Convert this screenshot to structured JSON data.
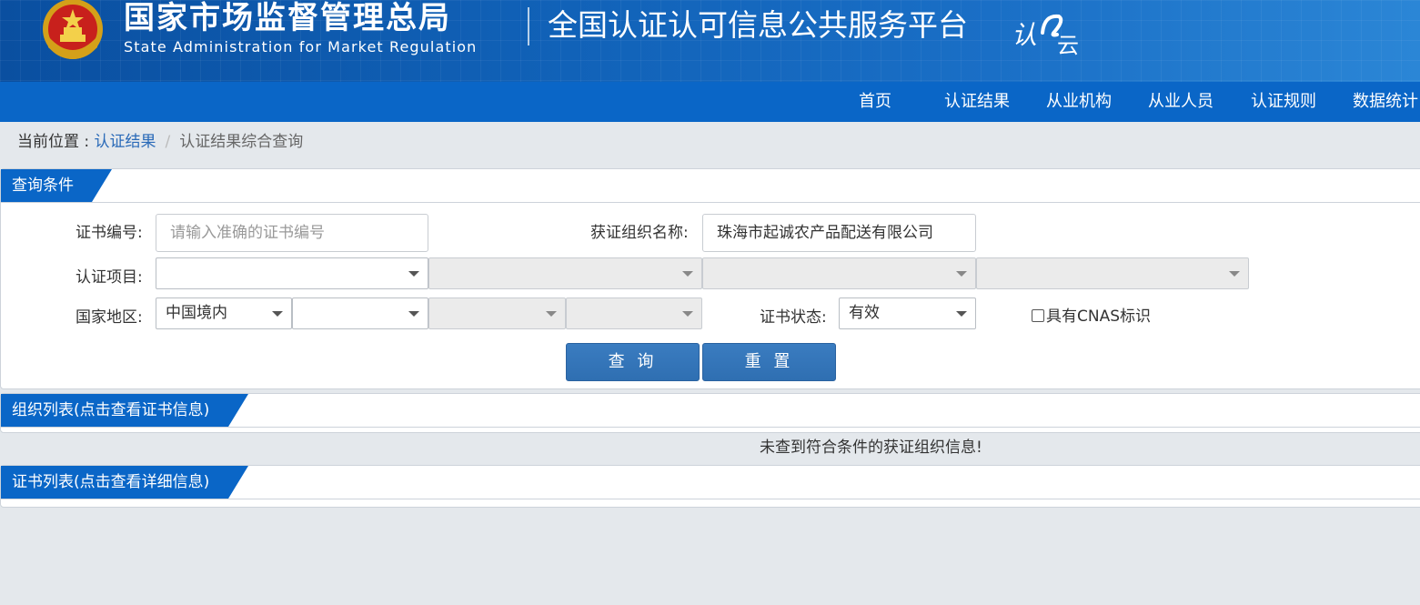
{
  "header": {
    "agency_cn": "国家市场监督管理总局",
    "agency_en": "State Administration for Market Regulation",
    "platform_title": "全国认证认可信息公共服务平台",
    "logo_text": "认云",
    "emblem_icon": "national-emblem-icon",
    "colors": {
      "header_bg": "#1162b8",
      "nav_bg": "#0a66c7",
      "accent": "#2f6fb2"
    }
  },
  "nav": {
    "items": [
      {
        "label": "首页"
      },
      {
        "label": "认证结果"
      },
      {
        "label": "从业机构"
      },
      {
        "label": "从业人员"
      },
      {
        "label": "认证规则"
      },
      {
        "label": "数据统计"
      }
    ]
  },
  "breadcrumb": {
    "prefix": "当前位置 : ",
    "link": "认证结果",
    "separator": "/",
    "current": "认证结果综合查询"
  },
  "query": {
    "title": "查询条件",
    "cert_no_label": "证书编号:",
    "cert_no_placeholder": "请输入准确的证书编号",
    "cert_no_value": "",
    "org_name_label": "获证组织名称:",
    "org_name_value": "珠海市起诚农产品配送有限公司",
    "project_label": "认证项目:",
    "project_selects": [
      "",
      "",
      "",
      ""
    ],
    "region_label": "国家地区:",
    "region_selects": [
      "中国境内",
      "",
      "",
      ""
    ],
    "status_label": "证书状态:",
    "status_value": "有效",
    "cnas_label": "具有CNAS标识",
    "cnas_checked": false,
    "search_button": "查 询",
    "reset_button": "重 置"
  },
  "org_list": {
    "title": "组织列表(点击查看证书信息)",
    "empty_message": "未查到符合条件的获证组织信息!"
  },
  "cert_list": {
    "title": "证书列表(点击查看详细信息)"
  }
}
